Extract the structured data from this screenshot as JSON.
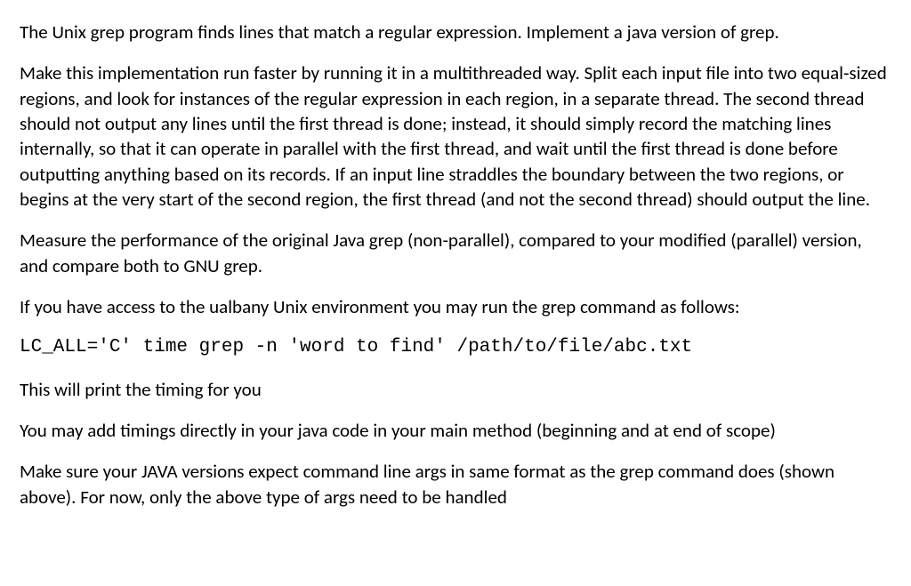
{
  "paragraphs": {
    "p1": "The Unix grep program finds lines that match a regular expression. Implement a java version of grep.",
    "p2": "Make this implementation run faster by running it in a multithreaded way. Split each input file into two equal-sized regions, and look for instances of the regular expression in each region, in a separate thread. The second thread should not output any lines until the first thread is done; instead, it should simply record the matching lines internally, so that it can operate in parallel with the first thread, and wait until the first thread is done before outputting anything based on its records. If an input line straddles the boundary between the two regions, or begins at the very start of the second region, the first thread (and not the second thread) should output the line.",
    "p3": "Measure the performance of the original Java grep (non-parallel), compared to your modified (parallel) version, and compare both to GNU grep.",
    "p4": "If you have access to the ualbany Unix environment you may run the grep command as follows:",
    "p5": "LC_ALL='C' time grep -n 'word to find' /path/to/file/abc.txt",
    "p6": "This will print the timing for you",
    "p7": "You may add timings directly in your java code in your main method (beginning and at end of scope)",
    "p8": "Make sure your JAVA versions expect command line args in same format as the grep command does (shown above). For now, only the above type of args need to be handled"
  }
}
